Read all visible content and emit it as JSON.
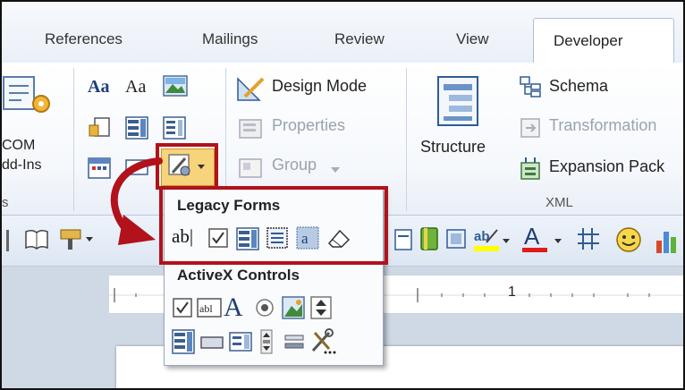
{
  "tabs": [
    {
      "label": "References"
    },
    {
      "label": "Mailings"
    },
    {
      "label": "Review"
    },
    {
      "label": "View"
    },
    {
      "label": "Developer",
      "active": true
    }
  ],
  "ribbon": {
    "addins_group": {
      "line1": "COM",
      "line2": "dd-Ins",
      "label": "s"
    },
    "design_mode": "Design Mode",
    "properties": "Properties",
    "group": "Group",
    "structure": "Structure",
    "xml": {
      "schema": "Schema",
      "transformation": "Transformation",
      "expansion": "Expansion Pack",
      "label": "XML"
    }
  },
  "controls_row": {
    "text_aa_rich": "Aa",
    "text_aa_plain": "Aa"
  },
  "dropdown": {
    "legacy_label": "Legacy Forms",
    "legacy_text_field": "ab|",
    "activex_label": "ActiveX Controls",
    "ruler_mark": "1"
  },
  "colors": {
    "accent_red": "#b1121b",
    "ribbon_border": "#b9c9dd"
  }
}
